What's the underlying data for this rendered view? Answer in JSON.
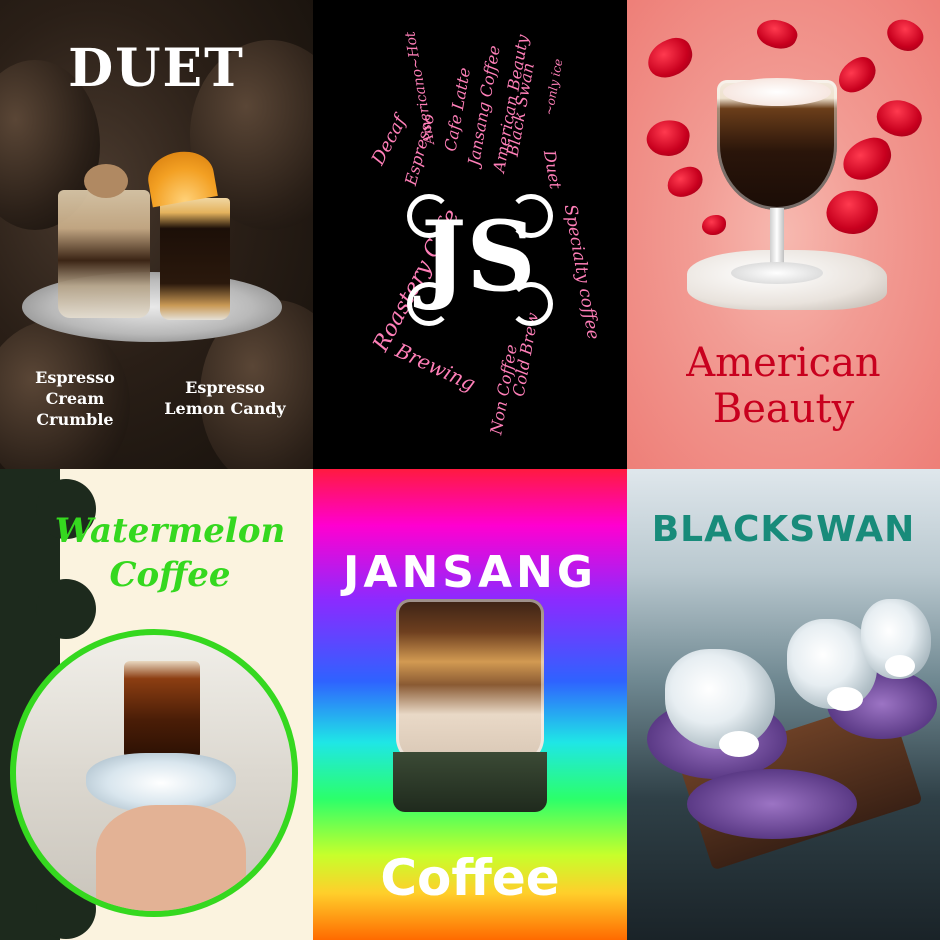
{
  "tiles": {
    "duet": {
      "title": "DUET",
      "label_1_lines": [
        "Espresso",
        "Cream",
        "Crumble"
      ],
      "label_2_lines": [
        "Espresso",
        "Lemon Candy"
      ]
    },
    "logo": {
      "monogram": "JS",
      "words": [
        "Roastery Cafe",
        "Decaf",
        "Espresso",
        "Americano~Hot",
        "Cafe Latte",
        "Jansang Coffee",
        "American Beauty",
        "Black Swan",
        "~only ice",
        "Duet",
        "Specialty coffee",
        "Cold Brew",
        "Non Coffee",
        "Brewing"
      ]
    },
    "american_beauty": {
      "title_lines": [
        "American",
        "Beauty"
      ]
    },
    "watermelon": {
      "title_lines": [
        "Watermelon",
        "Coffee"
      ]
    },
    "jansang": {
      "top_text": "JANSANG",
      "bottom_text": "Coffee"
    },
    "blackswan": {
      "title": "BLACKSWAN"
    }
  },
  "colors": {
    "logo_text": "#ff7fb8",
    "american_beauty_title": "#c8001e",
    "watermelon_green": "#35d81f",
    "blackswan_teal": "#188b7a"
  }
}
